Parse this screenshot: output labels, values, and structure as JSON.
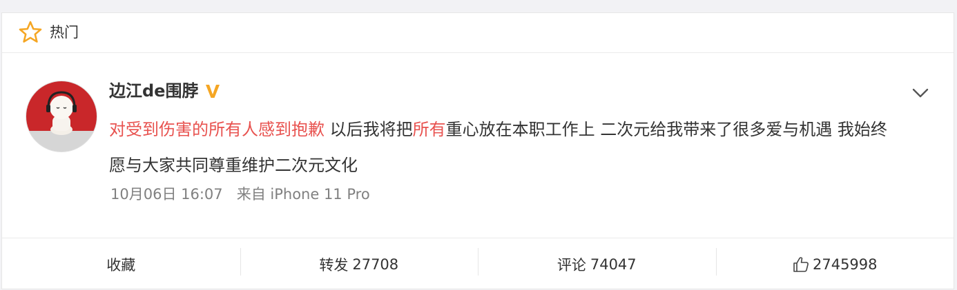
{
  "header": {
    "icon": "star-icon",
    "label": "热门"
  },
  "post": {
    "author": "边江de围脖",
    "verified_icon": "verified-v-icon",
    "avatar": "avatar-cartoon-headphones",
    "menu_icon": "chevron-down-icon",
    "text_segments": [
      {
        "text": "对受到伤害的所有人感到抱歉",
        "highlight": true
      },
      {
        "text": " 以后我将把",
        "highlight": false
      },
      {
        "text": "所有",
        "highlight": true
      },
      {
        "text": "重心放在本职工作上 二次元给我带来了很多爱与机遇 我始终愿与大家共同尊重维护二次元文化",
        "highlight": false
      }
    ],
    "timestamp": "10月06日 16:07",
    "source_prefix": "来自",
    "source": "iPhone 11 Pro"
  },
  "actions": {
    "favorite_label": "收藏",
    "repost_label": "转发",
    "repost_count": "27708",
    "comment_label": "评论",
    "comment_count": "74047",
    "like_icon": "thumbs-up-icon",
    "like_count": "2745998"
  },
  "colors": {
    "highlight": "#e8524f",
    "star": "#f5a623",
    "verified": "#f5a623",
    "avatar_red": "#c9272a"
  }
}
